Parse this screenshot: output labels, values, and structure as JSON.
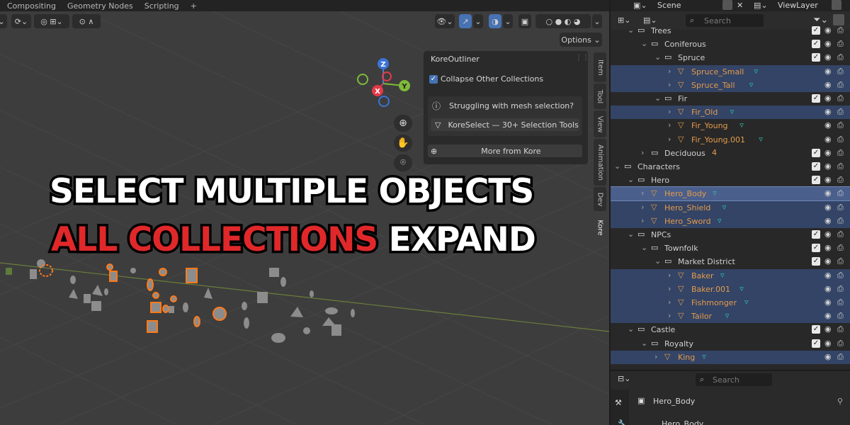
{
  "workspaces": [
    "Compositing",
    "Geometry Nodes",
    "Scripting",
    "+"
  ],
  "scene": {
    "label": "Scene",
    "viewlayer": "ViewLayer"
  },
  "viewport": {
    "options_label": "Options",
    "gizmo": {
      "z": "Z",
      "y": "Y",
      "x": "X"
    }
  },
  "kore_panel": {
    "title": "KoreOutliner",
    "collapse_label": "Collapse Other Collections",
    "collapse_checked": true,
    "help_text": "Struggling with mesh selection?",
    "select_button": "KoreSelect — 30+ Selection Tools",
    "more_button": "More from Kore"
  },
  "side_tabs": [
    "Item",
    "Tool",
    "View",
    "Animation",
    "Dev",
    "Kore"
  ],
  "headline": {
    "line1": "SELECT MULTIPLE OBJECTS",
    "line2_red": "ALL COLLECTIONS",
    "line2_white": "EXPAND"
  },
  "colors": {
    "accent": "#4772b3",
    "object_orange": "#e59a4b",
    "headline_red": "#e0282a",
    "selection_row": "#334466"
  },
  "outliner": {
    "search_placeholder": "Search",
    "rows": [
      {
        "label": "Trees",
        "kind": "collection",
        "state": "normal"
      },
      {
        "label": "Coniferous",
        "kind": "collection",
        "state": "normal"
      },
      {
        "label": "Spruce",
        "kind": "collection",
        "state": "normal"
      },
      {
        "label": "Spruce_Small",
        "kind": "object",
        "state": "selected"
      },
      {
        "label": "Spruce_Tall",
        "kind": "object",
        "state": "selected"
      },
      {
        "label": "Fir",
        "kind": "collection",
        "state": "normal"
      },
      {
        "label": "Fir_Old",
        "kind": "object",
        "state": "selected"
      },
      {
        "label": "Fir_Young",
        "kind": "object",
        "state": "normal"
      },
      {
        "label": "Fir_Young.001",
        "kind": "object",
        "state": "normal"
      },
      {
        "label": "Deciduous",
        "kind": "collection",
        "state": "normal",
        "badge": "4"
      },
      {
        "label": "Characters",
        "kind": "collection",
        "state": "normal"
      },
      {
        "label": "Hero",
        "kind": "collection",
        "state": "normal"
      },
      {
        "label": "Hero_Body",
        "kind": "object",
        "state": "active"
      },
      {
        "label": "Hero_Shield",
        "kind": "object",
        "state": "selected"
      },
      {
        "label": "Hero_Sword",
        "kind": "object",
        "state": "selected"
      },
      {
        "label": "NPCs",
        "kind": "collection",
        "state": "normal"
      },
      {
        "label": "Townfolk",
        "kind": "collection",
        "state": "normal"
      },
      {
        "label": "Market District",
        "kind": "collection",
        "state": "normal"
      },
      {
        "label": "Baker",
        "kind": "object",
        "state": "selected"
      },
      {
        "label": "Baker.001",
        "kind": "object",
        "state": "selected"
      },
      {
        "label": "Fishmonger",
        "kind": "object",
        "state": "selected"
      },
      {
        "label": "Tailor",
        "kind": "object",
        "state": "selected"
      },
      {
        "label": "Castle",
        "kind": "collection",
        "state": "normal"
      },
      {
        "label": "Royalty",
        "kind": "collection",
        "state": "normal"
      },
      {
        "label": "King",
        "kind": "object",
        "state": "selected"
      }
    ]
  },
  "properties": {
    "search_placeholder": "Search",
    "object_name": "Hero_Body",
    "object_name_2": "Hero_Body"
  }
}
